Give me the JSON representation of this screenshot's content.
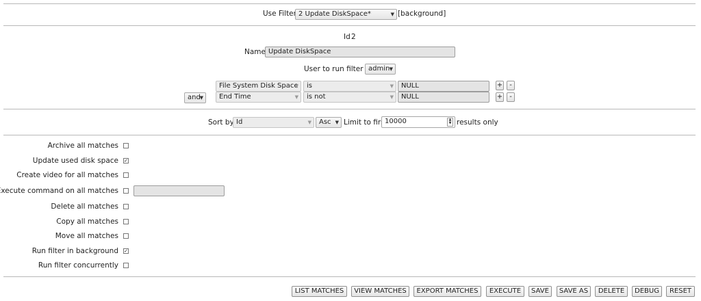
{
  "filter_select": {
    "label": "Use Filter",
    "value": "2 Update DiskSpace*",
    "note": "[background]"
  },
  "id": {
    "label": "Id",
    "value": "2"
  },
  "name": {
    "label": "Name",
    "value": "Update DiskSpace"
  },
  "user_run_as": {
    "label": "User to run filter as",
    "value": "admin"
  },
  "terms": [
    {
      "conj": "",
      "field": "File System Disk Space",
      "op": "is",
      "value": "NULL"
    },
    {
      "conj": "and",
      "field": "End Time",
      "op": "is not",
      "value": "NULL"
    }
  ],
  "sort": {
    "label": "Sort by",
    "field": "Id",
    "direction": "Asc",
    "limit_label": "Limit to first",
    "limit": "10000",
    "suffix": "results only"
  },
  "actions": [
    {
      "label": "Archive all matches",
      "checked": false,
      "check_glyph": ""
    },
    {
      "label": "Update used disk space",
      "checked": true,
      "check_glyph": "✓"
    },
    {
      "label": "Create video for all matches",
      "checked": false,
      "check_glyph": ""
    },
    {
      "label": "Execute command on all matches",
      "checked": false,
      "check_glyph": "",
      "command": ""
    },
    {
      "label": "Delete all matches",
      "checked": false,
      "check_glyph": ""
    },
    {
      "label": "Copy all matches",
      "checked": false,
      "check_glyph": ""
    },
    {
      "label": "Move all matches",
      "checked": false,
      "check_glyph": ""
    },
    {
      "label": "Run filter in background",
      "checked": true,
      "check_glyph": "✓"
    },
    {
      "label": "Run filter concurrently",
      "checked": false,
      "check_glyph": ""
    }
  ],
  "buttons": {
    "list_matches": "LIST MATCHES",
    "view_matches": "VIEW MATCHES",
    "export_matches": "EXPORT MATCHES",
    "execute": "EXECUTE",
    "save": "SAVE",
    "save_as": "SAVE AS",
    "delete": "DELETE",
    "debug": "DEBUG",
    "reset": "RESET"
  },
  "glyphs": {
    "plus": "+",
    "minus": "-",
    "dropdown_arrow": "▼",
    "spin_up": "▲",
    "spin_down": "▼"
  },
  "colors": {
    "divider": "#b8b8b8",
    "field_bg": "#e4e4e4"
  }
}
